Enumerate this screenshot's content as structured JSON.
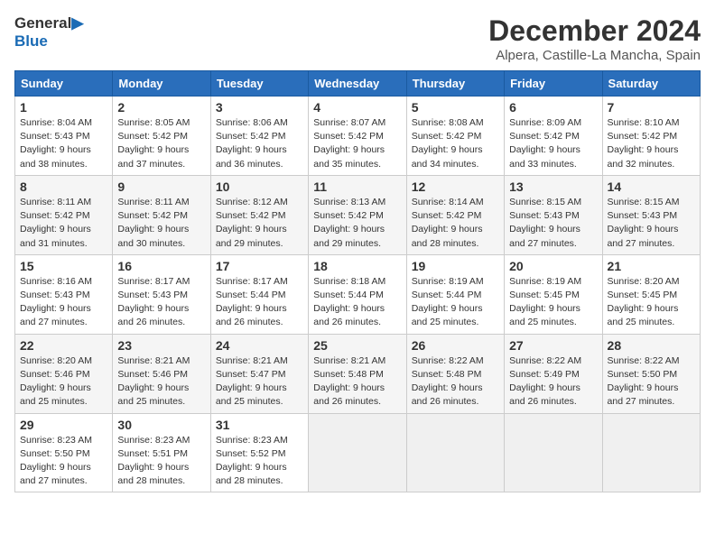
{
  "logo": {
    "line1": "General",
    "line2": "Blue"
  },
  "title": "December 2024",
  "location": "Alpera, Castille-La Mancha, Spain",
  "headers": [
    "Sunday",
    "Monday",
    "Tuesday",
    "Wednesday",
    "Thursday",
    "Friday",
    "Saturday"
  ],
  "weeks": [
    [
      {
        "day": "1",
        "sunrise": "8:04 AM",
        "sunset": "5:43 PM",
        "daylight": "9 hours and 38 minutes."
      },
      {
        "day": "2",
        "sunrise": "8:05 AM",
        "sunset": "5:42 PM",
        "daylight": "9 hours and 37 minutes."
      },
      {
        "day": "3",
        "sunrise": "8:06 AM",
        "sunset": "5:42 PM",
        "daylight": "9 hours and 36 minutes."
      },
      {
        "day": "4",
        "sunrise": "8:07 AM",
        "sunset": "5:42 PM",
        "daylight": "9 hours and 35 minutes."
      },
      {
        "day": "5",
        "sunrise": "8:08 AM",
        "sunset": "5:42 PM",
        "daylight": "9 hours and 34 minutes."
      },
      {
        "day": "6",
        "sunrise": "8:09 AM",
        "sunset": "5:42 PM",
        "daylight": "9 hours and 33 minutes."
      },
      {
        "day": "7",
        "sunrise": "8:10 AM",
        "sunset": "5:42 PM",
        "daylight": "9 hours and 32 minutes."
      }
    ],
    [
      {
        "day": "8",
        "sunrise": "8:11 AM",
        "sunset": "5:42 PM",
        "daylight": "9 hours and 31 minutes."
      },
      {
        "day": "9",
        "sunrise": "8:11 AM",
        "sunset": "5:42 PM",
        "daylight": "9 hours and 30 minutes."
      },
      {
        "day": "10",
        "sunrise": "8:12 AM",
        "sunset": "5:42 PM",
        "daylight": "9 hours and 29 minutes."
      },
      {
        "day": "11",
        "sunrise": "8:13 AM",
        "sunset": "5:42 PM",
        "daylight": "9 hours and 29 minutes."
      },
      {
        "day": "12",
        "sunrise": "8:14 AM",
        "sunset": "5:42 PM",
        "daylight": "9 hours and 28 minutes."
      },
      {
        "day": "13",
        "sunrise": "8:15 AM",
        "sunset": "5:43 PM",
        "daylight": "9 hours and 27 minutes."
      },
      {
        "day": "14",
        "sunrise": "8:15 AM",
        "sunset": "5:43 PM",
        "daylight": "9 hours and 27 minutes."
      }
    ],
    [
      {
        "day": "15",
        "sunrise": "8:16 AM",
        "sunset": "5:43 PM",
        "daylight": "9 hours and 27 minutes."
      },
      {
        "day": "16",
        "sunrise": "8:17 AM",
        "sunset": "5:43 PM",
        "daylight": "9 hours and 26 minutes."
      },
      {
        "day": "17",
        "sunrise": "8:17 AM",
        "sunset": "5:44 PM",
        "daylight": "9 hours and 26 minutes."
      },
      {
        "day": "18",
        "sunrise": "8:18 AM",
        "sunset": "5:44 PM",
        "daylight": "9 hours and 26 minutes."
      },
      {
        "day": "19",
        "sunrise": "8:19 AM",
        "sunset": "5:44 PM",
        "daylight": "9 hours and 25 minutes."
      },
      {
        "day": "20",
        "sunrise": "8:19 AM",
        "sunset": "5:45 PM",
        "daylight": "9 hours and 25 minutes."
      },
      {
        "day": "21",
        "sunrise": "8:20 AM",
        "sunset": "5:45 PM",
        "daylight": "9 hours and 25 minutes."
      }
    ],
    [
      {
        "day": "22",
        "sunrise": "8:20 AM",
        "sunset": "5:46 PM",
        "daylight": "9 hours and 25 minutes."
      },
      {
        "day": "23",
        "sunrise": "8:21 AM",
        "sunset": "5:46 PM",
        "daylight": "9 hours and 25 minutes."
      },
      {
        "day": "24",
        "sunrise": "8:21 AM",
        "sunset": "5:47 PM",
        "daylight": "9 hours and 25 minutes."
      },
      {
        "day": "25",
        "sunrise": "8:21 AM",
        "sunset": "5:48 PM",
        "daylight": "9 hours and 26 minutes."
      },
      {
        "day": "26",
        "sunrise": "8:22 AM",
        "sunset": "5:48 PM",
        "daylight": "9 hours and 26 minutes."
      },
      {
        "day": "27",
        "sunrise": "8:22 AM",
        "sunset": "5:49 PM",
        "daylight": "9 hours and 26 minutes."
      },
      {
        "day": "28",
        "sunrise": "8:22 AM",
        "sunset": "5:50 PM",
        "daylight": "9 hours and 27 minutes."
      }
    ],
    [
      {
        "day": "29",
        "sunrise": "8:23 AM",
        "sunset": "5:50 PM",
        "daylight": "9 hours and 27 minutes."
      },
      {
        "day": "30",
        "sunrise": "8:23 AM",
        "sunset": "5:51 PM",
        "daylight": "9 hours and 28 minutes."
      },
      {
        "day": "31",
        "sunrise": "8:23 AM",
        "sunset": "5:52 PM",
        "daylight": "9 hours and 28 minutes."
      },
      null,
      null,
      null,
      null
    ]
  ]
}
